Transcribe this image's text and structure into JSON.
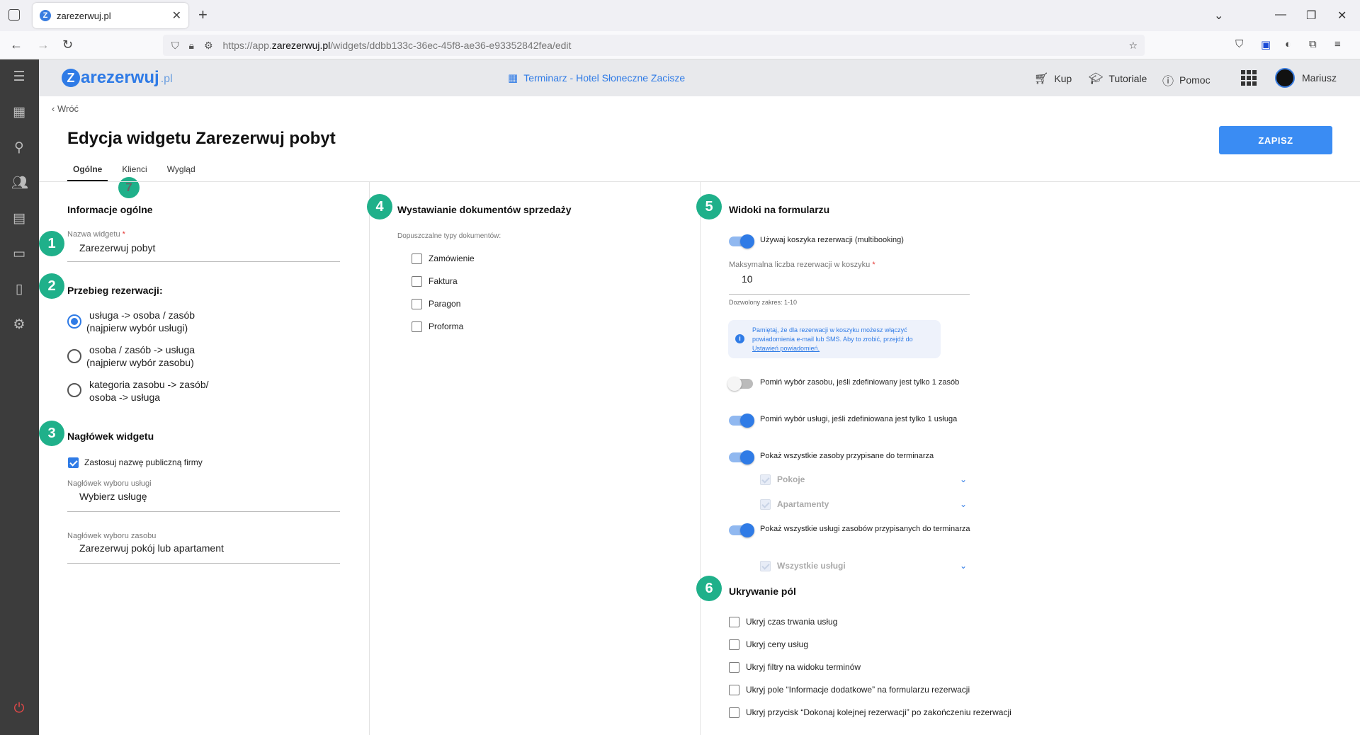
{
  "browser": {
    "tab_title": "zarezerwuj.pl",
    "url_prefix": "https://app.",
    "url_domain": "zarezerwuj.pl",
    "url_path": "/widgets/ddbb133c-36ec-45f8-ae36-e93352842fea/edit"
  },
  "header": {
    "logo_text": "arezerwuj",
    "logo_suffix": ".pl",
    "calendar_title": "Terminarz - Hotel Słoneczne Zacisze",
    "menu": {
      "buy": "Kup",
      "tutorials": "Tutoriale",
      "help": "Pomoc"
    },
    "user_name": "Mariusz"
  },
  "page": {
    "back_label": "Wróć",
    "title": "Edycja widgetu Zarezerwuj pobyt",
    "save_label": "ZAPISZ",
    "tabs": [
      "Ogólne",
      "Klienci",
      "Wygląd"
    ]
  },
  "badges": [
    "1",
    "2",
    "3",
    "4",
    "5",
    "6",
    "7"
  ],
  "general": {
    "section_title": "Informacje ogólne",
    "widget_name_label": "Nazwa widgetu",
    "widget_name_value": "Zarezerwuj pobyt",
    "flow_title": "Przebieg rezerwacji:",
    "flow_options": [
      {
        "line1": "usługa -> osoba / zasób",
        "line2": "(najpierw wybór usługi)",
        "selected": true
      },
      {
        "line1": "osoba / zasób -> usługa",
        "line2": "(najpierw wybór zasobu)",
        "selected": false
      },
      {
        "line1": "kategoria zasobu -> zasób/",
        "line2": "osoba -> usługa",
        "selected": false
      }
    ],
    "header_title": "Nagłówek widgetu",
    "use_public_name": "Zastosuj nazwę publiczną firmy",
    "service_header_label": "Nagłówek wyboru usługi",
    "service_header_value": "Wybierz usługę",
    "resource_header_label": "Nagłówek wyboru zasobu",
    "resource_header_value": "Zarezerwuj pokój lub apartament"
  },
  "documents": {
    "section_title": "Wystawianie dokumentów sprzedaży",
    "types_label": "Dopuszczalne typy dokumentów:",
    "types": [
      "Zamówienie",
      "Faktura",
      "Paragon",
      "Proforma"
    ]
  },
  "views": {
    "section_title": "Widoki na formularzu",
    "multibooking": "Używaj koszyka rezerwacji (multibooking)",
    "max_label": "Maksymalna liczba rezerwacji w koszyku",
    "max_value": "10",
    "range_hint": "Dozwolony zakres: 1-10",
    "info_text": "Pamiętaj, że dla rezerwacji w koszyku możesz włączyć powiadomienia e-mail lub SMS. Aby to zrobić, przejdź do",
    "info_link": "Ustawień powiadomień.",
    "skip_resource": "Pomiń wybór zasobu, jeśli zdefiniowany jest tylko 1 zasób",
    "skip_service": "Pomiń wybór usługi, jeśli zdefiniowana jest tylko 1 usługa",
    "show_resources": "Pokaż wszystkie zasoby przypisane do terminarza",
    "resource_groups": [
      "Pokoje",
      "Apartamenty"
    ],
    "show_services": "Pokaż wszystkie usługi zasobów przypisanych do terminarza",
    "service_groups": [
      "Wszystkie usługi"
    ]
  },
  "hiding": {
    "section_title": "Ukrywanie pól",
    "options": [
      "Ukryj czas trwania usług",
      "Ukryj ceny usług",
      "Ukryj filtry na widoku terminów",
      "Ukryj pole “Informacje dodatkowe” na formularzu rezerwacji",
      "Ukryj przycisk “Dokonaj kolejnej rezerwacji” po zakończeniu rezerwacji"
    ]
  },
  "colors": {
    "accent": "#2f7be6",
    "badge": "#1fb08a",
    "sidebar": "#3c3c3c"
  }
}
